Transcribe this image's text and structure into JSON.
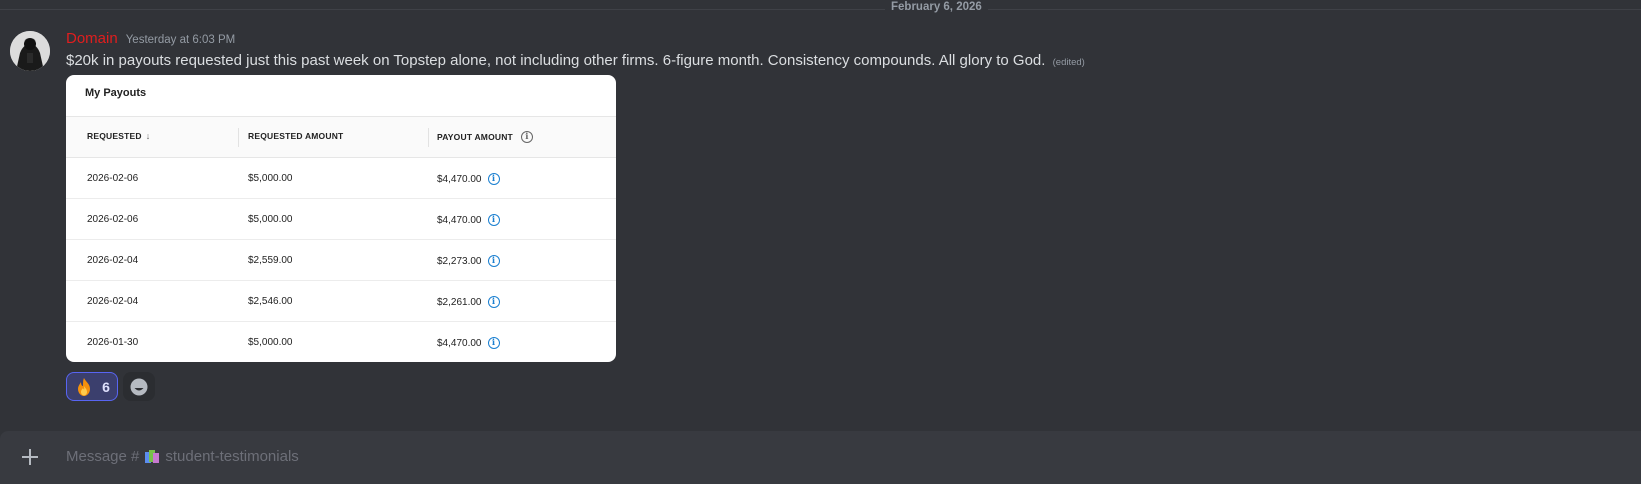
{
  "divider": {
    "date": "February 6, 2026"
  },
  "message": {
    "username": "Domain",
    "timestamp": "Yesterday at 6:03 PM",
    "text": "$20k in payouts requested just this past week on Topstep alone, not including other firms. 6-figure month. Consistency compounds. All glory to God.",
    "edited": "(edited)"
  },
  "payouts": {
    "title": "My Payouts",
    "columns": [
      "REQUESTED",
      "REQUESTED AMOUNT",
      "PAYOUT AMOUNT"
    ],
    "rows": [
      {
        "requested": "2026-02-06",
        "requested_amount": "$5,000.00",
        "payout_amount": "$4,470.00"
      },
      {
        "requested": "2026-02-06",
        "requested_amount": "$5,000.00",
        "payout_amount": "$4,470.00"
      },
      {
        "requested": "2026-02-04",
        "requested_amount": "$2,559.00",
        "payout_amount": "$2,273.00"
      },
      {
        "requested": "2026-02-04",
        "requested_amount": "$2,546.00",
        "payout_amount": "$2,261.00"
      },
      {
        "requested": "2026-01-30",
        "requested_amount": "$5,000.00",
        "payout_amount": "$4,470.00"
      }
    ]
  },
  "reactions": [
    {
      "emoji": "fire-icon",
      "count": "6"
    }
  ],
  "composer": {
    "placeholder_prefix": "Message #",
    "channel": "student-testimonials"
  },
  "colors": {
    "background": "#313338",
    "username": "#e01e1e",
    "reaction_border": "#5865f2",
    "info_icon": "#1a7fd0"
  }
}
